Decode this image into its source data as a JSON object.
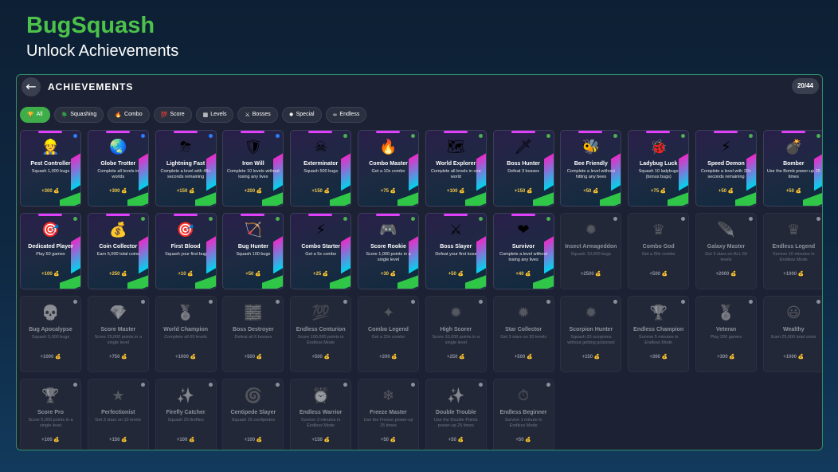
{
  "header": {
    "title": "BugSquash",
    "subtitle": "Unlock Achievements"
  },
  "panel": {
    "back_icon": "←",
    "title": "ACHIEVEMENTS",
    "count": "20/44"
  },
  "tabs": [
    {
      "icon": "🏆",
      "label": "All"
    },
    {
      "icon": "🪲",
      "label": "Squashing"
    },
    {
      "icon": "🔥",
      "label": "Combo"
    },
    {
      "icon": "💯",
      "label": "Score"
    },
    {
      "icon": "▦",
      "label": "Levels"
    },
    {
      "icon": "⚔",
      "label": "Bosses"
    },
    {
      "icon": "✹",
      "label": "Special"
    },
    {
      "icon": "∞",
      "label": "Endless"
    }
  ],
  "colors": {
    "accent": "#4cc24a",
    "panel_border": "#2f8f6a",
    "reward": "#f2c94c"
  },
  "achievements": [
    {
      "icon": "👷",
      "name": "Pest Controller",
      "desc": "Squash 1,000 bugs",
      "reward": "+300 💰",
      "unlocked": true
    },
    {
      "icon": "🌏",
      "name": "Globe Trotter",
      "desc": "Complete all levels in worlds",
      "reward": "+300 💰",
      "unlocked": true
    },
    {
      "icon": "⛈",
      "name": "Lightning Fast",
      "desc": "Complete a level with 45+ seconds remaining",
      "reward": "+150 💰",
      "unlocked": true
    },
    {
      "icon": "🛡",
      "name": "Iron Will",
      "desc": "Complete 10 levels without losing any lives",
      "reward": "+200 💰",
      "unlocked": true
    },
    {
      "icon": "☠",
      "name": "Exterminator",
      "desc": "Squash 500 bugs",
      "reward": "+150 💰",
      "unlocked": true
    },
    {
      "icon": "🔥",
      "name": "Combo Master",
      "desc": "Get a 10x combo",
      "reward": "+75 💰",
      "unlocked": true
    },
    {
      "icon": "🗺",
      "name": "World Explorer",
      "desc": "Complete all levels in one world",
      "reward": "+100 💰",
      "unlocked": true
    },
    {
      "icon": "🗡",
      "name": "Boss Hunter",
      "desc": "Defeat 3 bosses",
      "reward": "+150 💰",
      "unlocked": true
    },
    {
      "icon": "🐝",
      "name": "Bee Friendly",
      "desc": "Complete a level without hitting any bees",
      "reward": "+50 💰",
      "unlocked": true
    },
    {
      "icon": "🐞",
      "name": "Ladybug Luck",
      "desc": "Squash 10 ladybugs (bonus bugs)",
      "reward": "+75 💰",
      "unlocked": true
    },
    {
      "icon": "⚡",
      "name": "Speed Demon",
      "desc": "Complete a level with 30+ seconds remaining",
      "reward": "+50 💰",
      "unlocked": true
    },
    {
      "icon": "💣",
      "name": "Bomber",
      "desc": "Use the Bomb power-up 25 times",
      "reward": "+50 💰",
      "unlocked": true
    },
    {
      "icon": "🎯",
      "name": "Dedicated Player",
      "desc": "Play 50 games",
      "reward": "+100 💰",
      "unlocked": true
    },
    {
      "icon": "💰",
      "name": "Coin Collector",
      "desc": "Earn 5,000 total coins",
      "reward": "+250 💰",
      "unlocked": true
    },
    {
      "icon": "🎯",
      "name": "First Blood",
      "desc": "Squash your first bug",
      "reward": "+10 💰",
      "unlocked": true
    },
    {
      "icon": "🏹",
      "name": "Bug Hunter",
      "desc": "Squash 100 bugs",
      "reward": "+50 💰",
      "unlocked": true
    },
    {
      "icon": "⚡",
      "name": "Combo Starter",
      "desc": "Get a 5x combo",
      "reward": "+25 💰",
      "unlocked": true
    },
    {
      "icon": "🎮",
      "name": "Score Rookie",
      "desc": "Score 1,000 points in a single level",
      "reward": "+30 💰",
      "unlocked": true
    },
    {
      "icon": "⚔",
      "name": "Boss Slayer",
      "desc": "Defeat your first boss",
      "reward": "+50 💰",
      "unlocked": true
    },
    {
      "icon": "❤",
      "name": "Survivor",
      "desc": "Complete a level without losing any lives",
      "reward": "+40 💰",
      "unlocked": true
    },
    {
      "icon": "✹",
      "name": "Insect Armageddon",
      "desc": "Squash 10,000 bugs",
      "reward": "+2500 💰",
      "unlocked": false
    },
    {
      "icon": "♛",
      "name": "Combo God",
      "desc": "Get a 50x combo",
      "reward": "+500 💰",
      "unlocked": false
    },
    {
      "icon": "🪶",
      "name": "Galaxy Master",
      "desc": "Get 3 stars on ALL 60 levels",
      "reward": "+2000 💰",
      "unlocked": false
    },
    {
      "icon": "♛",
      "name": "Endless Legend",
      "desc": "Survive 10 minutes in Endless Mode",
      "reward": "+1000 💰",
      "unlocked": false
    },
    {
      "icon": "💀",
      "name": "Bug Apocalypse",
      "desc": "Squash 5,000 bugs",
      "reward": "+1000 💰",
      "unlocked": false
    },
    {
      "icon": "💎",
      "name": "Score Master",
      "desc": "Score 25,000 points in a single level",
      "reward": "+750 💰",
      "unlocked": false
    },
    {
      "icon": "🏅",
      "name": "World Champion",
      "desc": "Complete all 60 levels",
      "reward": "+1000 💰",
      "unlocked": false
    },
    {
      "icon": "🧱",
      "name": "Boss Destroyer",
      "desc": "Defeat all 6 bosses",
      "reward": "+500 💰",
      "unlocked": false
    },
    {
      "icon": "💯",
      "name": "Endless Centurion",
      "desc": "Score 100,000 points in Endless Mode",
      "reward": "+500 💰",
      "unlocked": false
    },
    {
      "icon": "✦",
      "name": "Combo Legend",
      "desc": "Get a 20x combo",
      "reward": "+200 💰",
      "unlocked": false
    },
    {
      "icon": "✹",
      "name": "High Scorer",
      "desc": "Score 10,000 points in a single level",
      "reward": "+250 💰",
      "unlocked": false
    },
    {
      "icon": "✹",
      "name": "Star Collector",
      "desc": "Get 3 stars on 30 levels",
      "reward": "+500 💰",
      "unlocked": false
    },
    {
      "icon": "✹",
      "name": "Scorpion Hunter",
      "desc": "Squash 20 scorpions without getting poisoned",
      "reward": "+150 💰",
      "unlocked": false
    },
    {
      "icon": "🏆",
      "name": "Endless Champion",
      "desc": "Survive 5 minutes in Endless Mode",
      "reward": "+300 💰",
      "unlocked": false
    },
    {
      "icon": "🏅",
      "name": "Veteran",
      "desc": "Play 200 games",
      "reward": "+300 💰",
      "unlocked": false
    },
    {
      "icon": "😃",
      "name": "Wealthy",
      "desc": "Earn 25,000 total coins",
      "reward": "+1000 💰",
      "unlocked": false
    },
    {
      "icon": "🏆",
      "name": "Score Pro",
      "desc": "Score 5,000 points in a single level",
      "reward": "+100 💰",
      "unlocked": false
    },
    {
      "icon": "★",
      "name": "Perfectionist",
      "desc": "Get 3 stars on 10 levels",
      "reward": "+150 💰",
      "unlocked": false
    },
    {
      "icon": "✨",
      "name": "Firefly Catcher",
      "desc": "Squash 25 fireflies",
      "reward": "+100 💰",
      "unlocked": false
    },
    {
      "icon": "🌀",
      "name": "Centipede Slayer",
      "desc": "Squash 15 centipedes",
      "reward": "+100 💰",
      "unlocked": false
    },
    {
      "icon": "⏰",
      "name": "Endless Warrior",
      "desc": "Survive 3 minutes in Endless Mode",
      "reward": "+150 💰",
      "unlocked": false
    },
    {
      "icon": "❄",
      "name": "Freeze Master",
      "desc": "Use the Freeze power-up 25 times",
      "reward": "+50 💰",
      "unlocked": false
    },
    {
      "icon": "✨",
      "name": "Double Trouble",
      "desc": "Use the Double Points power-up 25 times",
      "reward": "+50 💰",
      "unlocked": false
    },
    {
      "icon": "⏱",
      "name": "Endless Beginner",
      "desc": "Survive 1 minute in Endless Mode",
      "reward": "+50 💰",
      "unlocked": false
    }
  ]
}
